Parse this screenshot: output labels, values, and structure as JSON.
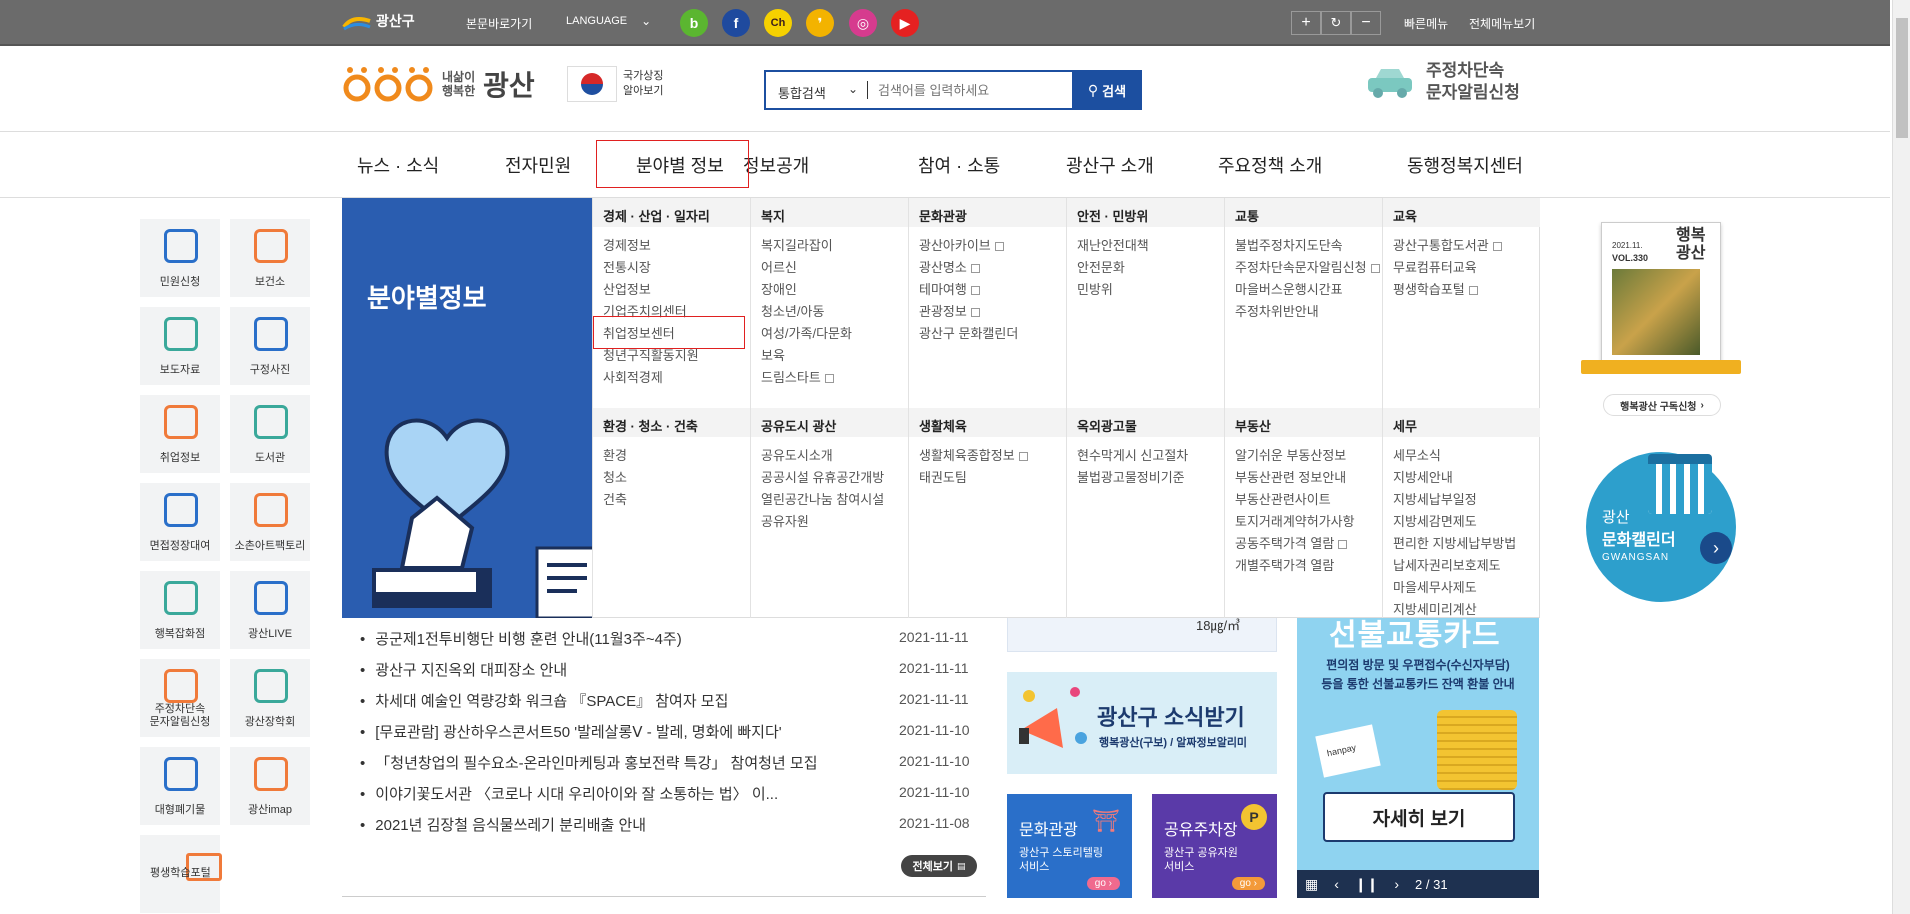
{
  "topbar": {
    "logo_text": "광산구",
    "skip_link": "본문바로가기",
    "language": "LANGUAGE",
    "sns": [
      {
        "name": "band-icon",
        "glyph": "b",
        "color": "#5bb630"
      },
      {
        "name": "facebook-icon",
        "glyph": "f",
        "color": "#1f4a9e"
      },
      {
        "name": "kakaochannel-icon",
        "glyph": "Ch",
        "color": "#f6d100"
      },
      {
        "name": "kakaostory-icon",
        "glyph": "❜",
        "color": "#f3b300"
      },
      {
        "name": "instagram-icon",
        "glyph": "◎",
        "color": "#d63b8e"
      },
      {
        "name": "youtube-icon",
        "glyph": "▶",
        "color": "#e52121"
      }
    ],
    "zoom_in": "+",
    "zoom_reset": "↻",
    "zoom_out": "−",
    "quick_menu": "빠른메뉴",
    "all_menu": "전체메뉴보기"
  },
  "header": {
    "brand_small": "내삶이\n행복한",
    "brand_big": "광산",
    "national_symbol": "국가상징\n알아보기",
    "search": {
      "scope": "통합검색",
      "placeholder": "검색어를 입력하세요",
      "button": "검색"
    },
    "parking_banner": "주정차단속\n문자알림신청"
  },
  "gnb": [
    "뉴스 · 소식",
    "전자민원",
    "분야별 정보",
    "정보공개",
    "참여 · 소통",
    "광산구 소개",
    "주요정책 소개",
    "동행정복지센터"
  ],
  "quick_menu": [
    {
      "label": "민원신청",
      "icon": "chat-icon"
    },
    {
      "label": "보건소",
      "icon": "medical-kit-icon"
    },
    {
      "label": "보도자료",
      "icon": "tv-icon"
    },
    {
      "label": "구정사진",
      "icon": "camera-icon"
    },
    {
      "label": "취업정보",
      "icon": "people-icon"
    },
    {
      "label": "도서관",
      "icon": "books-icon"
    },
    {
      "label": "면접정장대여",
      "icon": "suit-icon"
    },
    {
      "label": "소촌아트팩토리",
      "icon": "art-factory-icon"
    },
    {
      "label": "행복잡화점",
      "icon": "heart-house-icon"
    },
    {
      "label": "광산LIVE",
      "icon": "video-camera-icon"
    },
    {
      "label": "주정차단속\n문자알림신청",
      "icon": "no-parking-icon"
    },
    {
      "label": "광산장학회",
      "icon": "graduation-cap-icon"
    },
    {
      "label": "대형폐기물",
      "icon": "cart-icon"
    },
    {
      "label": "광산imap",
      "icon": "imap-logo-icon"
    },
    {
      "label": "평생학습포털",
      "icon": "monitor-icon"
    }
  ],
  "mega_menu": {
    "title": "분야별정보",
    "row1": [
      {
        "heading": "경제 · 산업 · 일자리",
        "items": [
          {
            "t": "경제정보"
          },
          {
            "t": "전통시장"
          },
          {
            "t": "산업정보"
          },
          {
            "t": "기업주치의센터"
          },
          {
            "t": "취업정보센터"
          },
          {
            "t": "청년구직활동지원"
          },
          {
            "t": "사회적경제"
          }
        ]
      },
      {
        "heading": "복지",
        "items": [
          {
            "t": "복지길라잡이"
          },
          {
            "t": "어르신"
          },
          {
            "t": "장애인"
          },
          {
            "t": "청소년/아동"
          },
          {
            "t": "여성/가족/다문화"
          },
          {
            "t": "보육"
          },
          {
            "t": "드림스타트",
            "ext": true
          }
        ]
      },
      {
        "heading": "문화관광",
        "items": [
          {
            "t": "광산아카이브",
            "ext": true
          },
          {
            "t": "광산명소",
            "ext": true
          },
          {
            "t": "테마여행",
            "ext": true
          },
          {
            "t": "관광정보",
            "ext": true
          },
          {
            "t": "광산구 문화캘린더"
          }
        ]
      },
      {
        "heading": "안전 · 민방위",
        "items": [
          {
            "t": "재난안전대책"
          },
          {
            "t": "안전문화"
          },
          {
            "t": "민방위"
          }
        ]
      },
      {
        "heading": "교통",
        "items": [
          {
            "t": "불법주정차지도단속"
          },
          {
            "t": "주정차단속문자알림신청",
            "ext": true
          },
          {
            "t": "마을버스운행시간표"
          },
          {
            "t": "주정차위반안내"
          }
        ]
      },
      {
        "heading": "교육",
        "items": [
          {
            "t": "광산구통합도서관",
            "ext": true
          },
          {
            "t": "무료컴퓨터교육"
          },
          {
            "t": "평생학습포털",
            "ext": true
          }
        ]
      }
    ],
    "row2": [
      {
        "heading": "환경 · 청소 · 건축",
        "items": [
          {
            "t": "환경"
          },
          {
            "t": "청소"
          },
          {
            "t": "건축"
          }
        ]
      },
      {
        "heading": "공유도시 광산",
        "items": [
          {
            "t": "공유도시소개"
          },
          {
            "t": "공공시설 유휴공간개방"
          },
          {
            "t": "열린공간나눔 참여시설"
          },
          {
            "t": "공유자원"
          }
        ]
      },
      {
        "heading": "생활체육",
        "items": [
          {
            "t": "생활체육종합정보",
            "ext": true
          },
          {
            "t": "태권도팀"
          }
        ]
      },
      {
        "heading": "옥외광고물",
        "items": [
          {
            "t": "현수막게시 신고절차"
          },
          {
            "t": "불법광고물정비기준"
          }
        ]
      },
      {
        "heading": "부동산",
        "items": [
          {
            "t": "알기쉬운 부동산정보"
          },
          {
            "t": "부동산관련 정보안내"
          },
          {
            "t": "부동산관련사이트"
          },
          {
            "t": "토지거래계약허가사항"
          },
          {
            "t": "공동주택가격 열람",
            "ext": true
          },
          {
            "t": "개별주택가격 열람"
          }
        ]
      },
      {
        "heading": "세무",
        "items": [
          {
            "t": "세무소식"
          },
          {
            "t": "지방세안내"
          },
          {
            "t": "지방세납부일정"
          },
          {
            "t": "지방세감면제도"
          },
          {
            "t": "편리한 지방세납부방법"
          },
          {
            "t": "납세자권리보호제도"
          },
          {
            "t": "마을세무사제도"
          },
          {
            "t": "지방세미리계산"
          }
        ]
      }
    ]
  },
  "news": [
    {
      "title": "공군제1전투비행단 비행 훈련 안내(11월3주~4주)",
      "date": "2021-11-11"
    },
    {
      "title": "광산구 지진옥외 대피장소 안내",
      "date": "2021-11-11"
    },
    {
      "title": "차세대 예술인 역량강화 워크숍 『SPACE』 참여자 모집",
      "date": "2021-11-11"
    },
    {
      "title": "[무료관람] 광산하우스콘서트50 '발레살롱Ⅴ - 발레, 명화에 빠지다'",
      "date": "2021-11-10"
    },
    {
      "title": "「청년창업의 필수요소-온라인마케팅과 홍보전략 특강」 참여청년 모집",
      "date": "2021-11-10"
    },
    {
      "title": "이야기꽃도서관 〈코로나 시대 우리아이와 잘 소통하는 법〉 이...",
      "date": "2021-11-10"
    },
    {
      "title": "2021년 김장철 음식물쓰레기 분리배출 안내",
      "date": "2021-11-08"
    }
  ],
  "news_more": "전체보기",
  "air": {
    "unit": "18㎍/㎥"
  },
  "sosik": {
    "title": "광산구 소식받기",
    "sub": "행복광산(구보) / 알짜정보알리미"
  },
  "culture_box": {
    "title": "문화관광",
    "sub": "광산구 스토리텔링\n서비스",
    "go": "go"
  },
  "parking_box": {
    "title": "공유주차장",
    "sub": "광산구 공유자원\n서비스",
    "go": "go"
  },
  "big_banner": {
    "headline": "선불교통카드",
    "desc": "편의점 방문 및 우편접수(수신자부담)\n등을 통한 선불교통카드 잔액 환불 안내",
    "card_label": "hanpay",
    "button": "자세히 보기",
    "pager": "2 / 31"
  },
  "magazine": {
    "issue": "2021.11.",
    "vol": "VOL.330",
    "title": "행복\n광산",
    "subscribe": "행복광산 구독신청"
  },
  "calendar": {
    "line1": "광산",
    "line2": "문화캘린더",
    "line3": "GWANGSAN"
  },
  "colors": {
    "primary": "#1c4fa0",
    "mega_side": "#2a5db0",
    "highlight": "#e02020",
    "topbar": "#6b6b6b"
  }
}
